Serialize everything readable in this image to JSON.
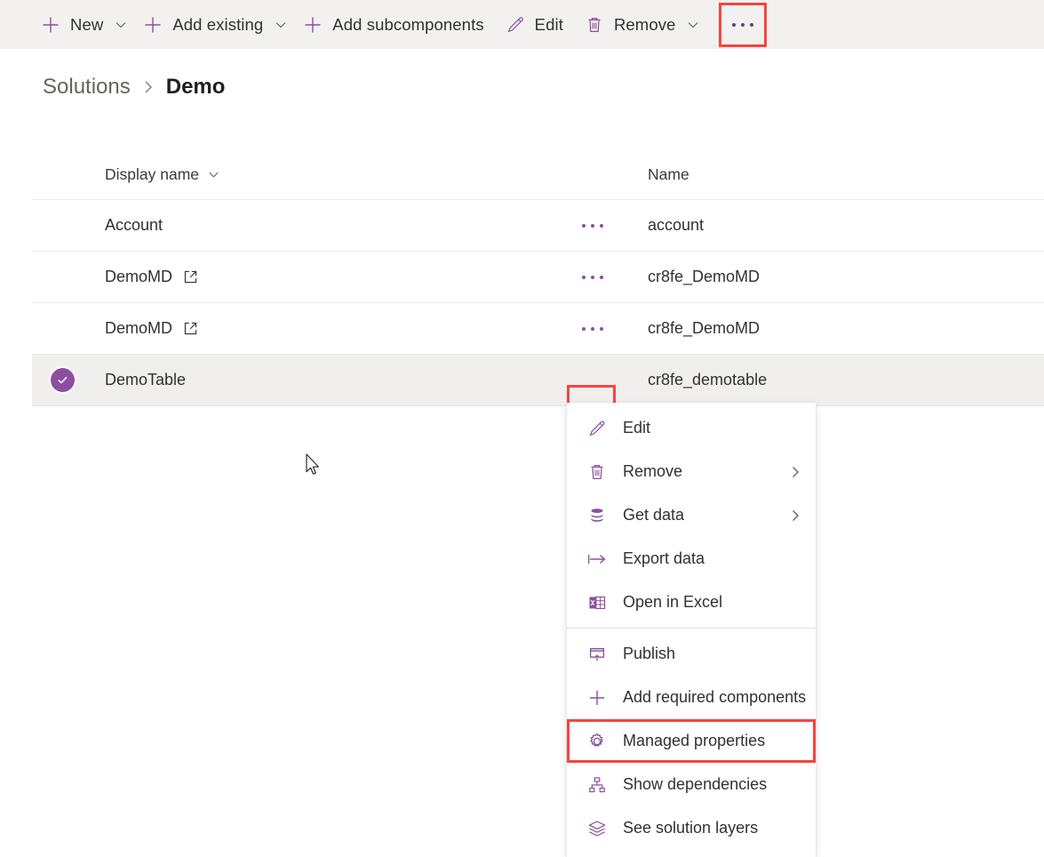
{
  "command_bar": {
    "buttons": [
      {
        "label": "New",
        "icon": "plus-icon",
        "has_caret": true
      },
      {
        "label": "Add existing",
        "icon": "plus-icon",
        "has_caret": true
      },
      {
        "label": "Add subcomponents",
        "icon": "plus-icon",
        "has_caret": false
      },
      {
        "label": "Edit",
        "icon": "pencil-icon",
        "has_caret": false
      },
      {
        "label": "Remove",
        "icon": "trash-icon",
        "has_caret": true
      }
    ],
    "overflow_label": "More commands",
    "highlight_color": "#f8443c"
  },
  "breadcrumb": {
    "parent": "Solutions",
    "separator": "›",
    "current": "Demo"
  },
  "grid": {
    "columns": {
      "display_name": "Display name",
      "name": "Name"
    },
    "rows": [
      {
        "display_name": "Account",
        "name": "account",
        "external_link": false,
        "selected": false,
        "actions": "…"
      },
      {
        "display_name": "DemoMD",
        "name": "cr8fe_DemoMD",
        "external_link": true,
        "selected": false,
        "actions": "…"
      },
      {
        "display_name": "DemoMD",
        "name": "cr8fe_DemoMD",
        "external_link": true,
        "selected": false,
        "actions": "…"
      },
      {
        "display_name": "DemoTable",
        "name": "cr8fe_demotable",
        "external_link": false,
        "selected": true,
        "actions": "…"
      }
    ],
    "selection_color": "#8c4f9f",
    "selected_row_background": "#f0efee"
  },
  "context_menu": {
    "items": [
      {
        "label": "Edit",
        "icon": "pencil-icon",
        "submenu": false,
        "highlighted": false
      },
      {
        "label": "Remove",
        "icon": "trash-icon",
        "submenu": true,
        "highlighted": false
      },
      {
        "label": "Get data",
        "icon": "database-icon",
        "submenu": true,
        "highlighted": false
      },
      {
        "label": "Export data",
        "icon": "export-arrow-icon",
        "submenu": false,
        "highlighted": false
      },
      {
        "label": "Open in Excel",
        "icon": "excel-icon",
        "submenu": false,
        "highlighted": false
      },
      {
        "label": "Publish",
        "icon": "publish-icon",
        "submenu": false,
        "highlighted": false
      },
      {
        "label": "Add required components",
        "icon": "plus-icon",
        "submenu": false,
        "highlighted": false
      },
      {
        "label": "Managed properties",
        "icon": "gear-icon",
        "submenu": false,
        "highlighted": true
      },
      {
        "label": "Show dependencies",
        "icon": "hierarchy-icon",
        "submenu": false,
        "highlighted": false
      },
      {
        "label": "See solution layers",
        "icon": "layers-icon",
        "submenu": false,
        "highlighted": false
      }
    ],
    "divider_after_index": 4,
    "accent_color": "#8a4f9e",
    "highlight_color": "#f8443c"
  }
}
